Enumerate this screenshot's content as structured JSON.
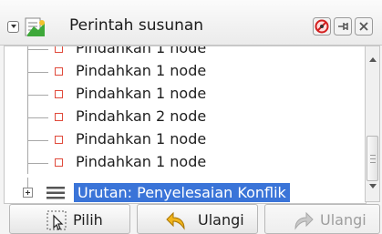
{
  "header": {
    "title": "Perintah susunan",
    "icons": [
      "collapse-icon",
      "history-icon",
      "delete-icon",
      "pin-icon",
      "close-icon"
    ]
  },
  "tree": {
    "items": [
      {
        "label": "Pindahkan 1 node"
      },
      {
        "label": "Pindahkan 1 node"
      },
      {
        "label": "Pindahkan 1 node"
      },
      {
        "label": "Pindahkan 2 node"
      },
      {
        "label": "Pindahkan 1 node"
      },
      {
        "label": "Pindahkan 1 node"
      }
    ],
    "selected_group": {
      "label": "Urutan: Penyelesaian Konflik"
    }
  },
  "buttons": {
    "select": "Pilih",
    "undo": "Ulangi",
    "redo": "Ulangi"
  },
  "colors": {
    "selection": "#3a74d8",
    "node_marker": "#e04a3b"
  }
}
